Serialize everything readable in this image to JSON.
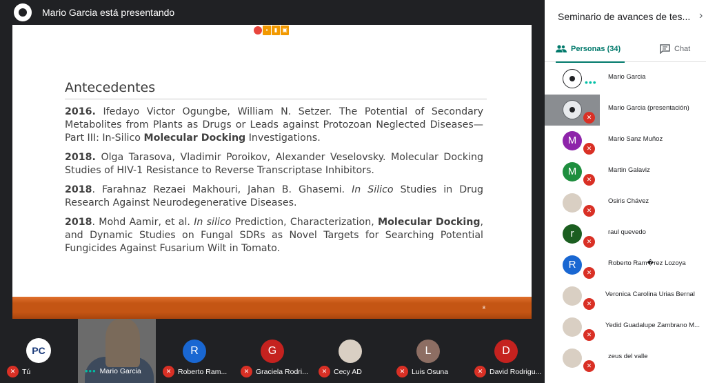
{
  "presenter_bar": {
    "title": "Mario Garcia está presentando"
  },
  "slide": {
    "heading": "Antecedentes",
    "page_number": "8",
    "refs": [
      {
        "year": "2016.",
        "pre": " Ifedayo Victor Ogungbe, William N. Setzer. The Potential of Secondary Metabolites from Plants as Drugs or Leads against Protozoan Neglected Diseases—Part III: In-Silico ",
        "bold": "Molecular Docking",
        "post": " Investigations."
      },
      {
        "year": "2018.",
        "pre": " Olga Tarasova, Vladimir Poroikov, Alexander Veselovsky. Molecular Docking Studies of HIV-1 Resistance to Reverse Transcriptase Inhibitors.",
        "bold": "",
        "post": ""
      },
      {
        "year": "2018",
        "pre": ". Farahnaz Rezaei Makhouri, Jahan B. Ghasemi. ",
        "italic": "In Silico",
        "post": " Studies in Drug Research Against Neurodegenerative Diseases."
      },
      {
        "year": "2018",
        "pre": ". Mohd Aamir, et al. ",
        "italic": "In silico",
        "mid": " Prediction, Characterization, ",
        "bold": "Molecular Docking",
        "post": ", and Dynamic Studies on Fungal SDRs as Novel Targets for Searching Potential Fungicides Against Fusarium Wilt in Tomato."
      }
    ]
  },
  "side_panel": {
    "meeting_title": "Seminario de avances de tes...",
    "tab_people": "Personas (34)",
    "tab_chat": "Chat",
    "participants": [
      {
        "name": "Mario Garcia",
        "avatar": "meet",
        "color": "",
        "status": "speaking"
      },
      {
        "name": "Mario Garcia (presentación)",
        "avatar": "meet-grey",
        "color": "",
        "status": "muted"
      },
      {
        "name": "Mario Sanz Muñoz",
        "avatar": "M",
        "color": "#8e24aa",
        "status": "muted"
      },
      {
        "name": "Martin Galaviz",
        "avatar": "M",
        "color": "#1e8e3e",
        "status": "muted"
      },
      {
        "name": "Osiris Chávez",
        "avatar": "photo",
        "color": "",
        "status": "muted"
      },
      {
        "name": "raul quevedo",
        "avatar": "r",
        "color": "#1b5e20",
        "status": "muted"
      },
      {
        "name": "Roberto Ram�rez Lozoya",
        "avatar": "R",
        "color": "#1967d2",
        "status": "muted"
      },
      {
        "name": "Veronica Carolina Urias Bernal",
        "avatar": "photo",
        "color": "",
        "status": "muted"
      },
      {
        "name": "Yedid Guadalupe Zambrano M...",
        "avatar": "photo",
        "color": "",
        "status": "muted"
      },
      {
        "name": "zeus del valle",
        "avatar": "photo",
        "color": "",
        "status": "muted"
      }
    ]
  },
  "filmstrip": [
    {
      "name": "Tú",
      "avatar": "PC",
      "color": "#ffffff",
      "status": "muted"
    },
    {
      "name": "Mario Garcia",
      "avatar": "video",
      "color": "",
      "status": "speaking"
    },
    {
      "name": "Roberto Ram...",
      "avatar": "R",
      "color": "#1967d2",
      "status": "muted"
    },
    {
      "name": "Graciela Rodri...",
      "avatar": "G",
      "color": "#c5221f",
      "status": "muted"
    },
    {
      "name": "Cecy AD",
      "avatar": "photo",
      "color": "",
      "status": "muted"
    },
    {
      "name": "Luis Osuna",
      "avatar": "L",
      "color": "#8d6e63",
      "status": "muted"
    },
    {
      "name": "David Rodrigu...",
      "avatar": "D",
      "color": "#c5221f",
      "status": "muted"
    }
  ],
  "icons": {
    "mic_off": "mic-off-icon",
    "people": "people-icon",
    "chat": "chat-icon",
    "close": "chevron-right-icon"
  }
}
